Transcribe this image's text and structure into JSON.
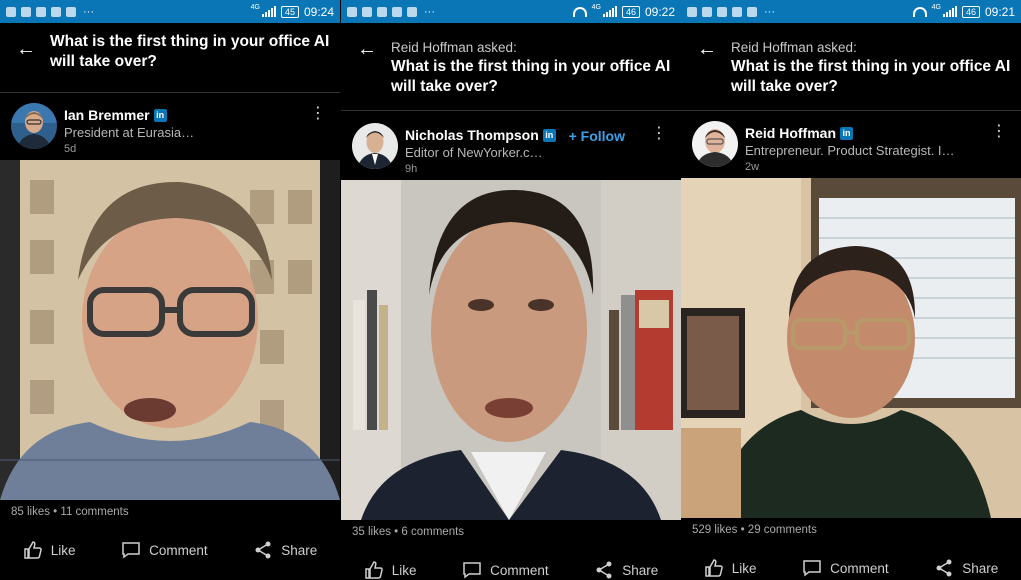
{
  "panels": [
    {
      "status": {
        "network": "4G",
        "battery": "45",
        "time": "09:24"
      },
      "asked_by": "",
      "question": "What is the first thing in your office AI will take over?",
      "author": {
        "name": "Ian Bremmer",
        "headline": "President at Eurasia…",
        "time": "5d"
      },
      "stats": "85 likes • 11 comments"
    },
    {
      "status": {
        "network": "4G",
        "battery": "46",
        "time": "09:22"
      },
      "asked_by": "Reid Hoffman asked:",
      "question": "What is the first thing in your office AI will take over?",
      "author": {
        "name": "Nicholas Thompson",
        "headline": "Editor of NewYorker.c…",
        "time": "9h"
      },
      "follow": "+ Follow",
      "stats": "35 likes • 6 comments"
    },
    {
      "status": {
        "network": "4G",
        "battery": "46",
        "time": "09:21"
      },
      "asked_by": "Reid Hoffman asked:",
      "question": "What is the first thing in your office AI will take over?",
      "author": {
        "name": "Reid Hoffman",
        "headline": "Entrepreneur. Product Strategist. I…",
        "time": "2w"
      },
      "stats": "529 likes • 29 comments"
    }
  ],
  "actions": {
    "like": "Like",
    "comment": "Comment",
    "share": "Share"
  },
  "statusbar": {
    "more": "···"
  },
  "colors": {
    "statusbar": "#0a76b5",
    "follow": "#3ea0e6",
    "background": "#000000"
  },
  "icons": [
    "back-arrow-icon",
    "linkedin-badge-icon",
    "more-vertical-icon",
    "like-icon",
    "comment-icon",
    "share-icon",
    "wifi-icon",
    "signal-icon",
    "battery-icon"
  ]
}
